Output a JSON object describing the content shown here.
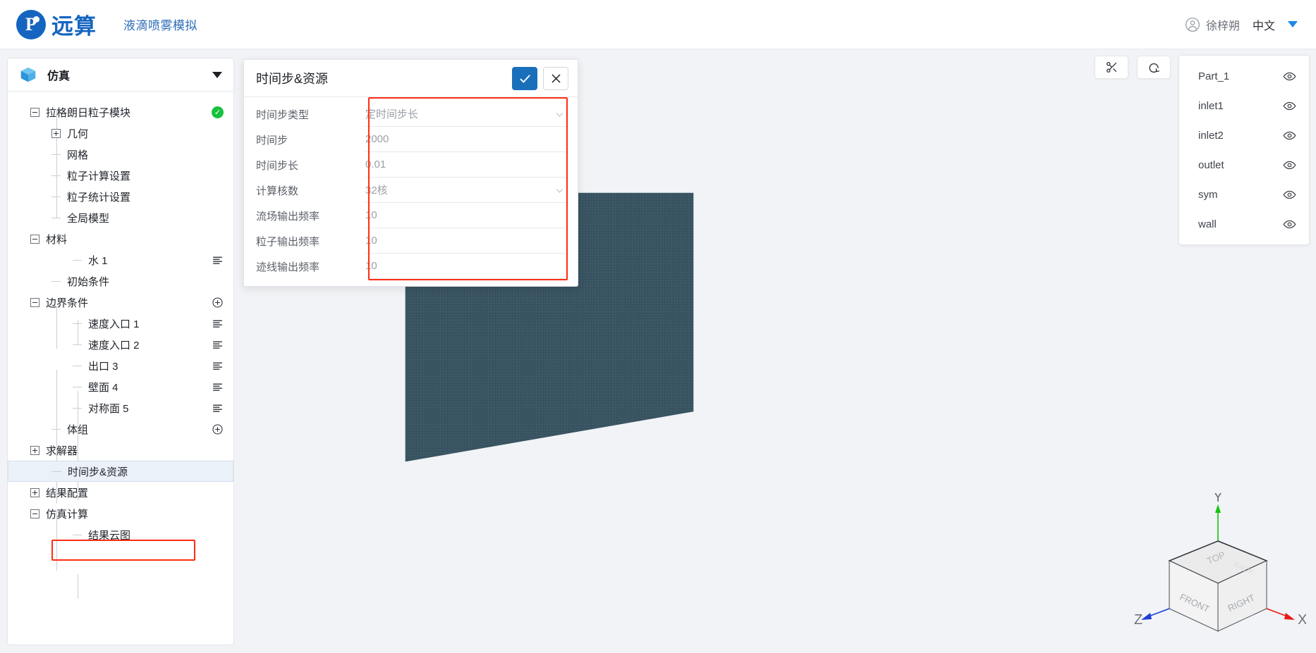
{
  "topbar": {
    "brand_name": "远算",
    "brand_glyph": "P",
    "app_title": "液滴喷雾模拟",
    "user_name": "徐梓朔",
    "language": "中文",
    "avatar_icon": "user-circle-icon",
    "caret_icon": "caret-down-icon",
    "brand_color": "#1565c0",
    "app_title_color": "#2b6cb8"
  },
  "sidebar": {
    "header": {
      "title": "仿真",
      "icon": "cube-icon",
      "caret_icon": "caret-down-icon"
    },
    "tree": [
      {
        "label": "拉格朗日粒子模块",
        "depth": 0,
        "toggle": "minus",
        "status_icon": "check-circle-icon",
        "status_color": "#17c13e"
      },
      {
        "label": "几何",
        "depth": 1,
        "toggle": "plus"
      },
      {
        "label": "网格",
        "depth": 1,
        "toggle": "leaf"
      },
      {
        "label": "粒子计算设置",
        "depth": 1,
        "toggle": "leaf"
      },
      {
        "label": "粒子统计设置",
        "depth": 1,
        "toggle": "leaf"
      },
      {
        "label": "全局模型",
        "depth": 1,
        "toggle": "leaf"
      },
      {
        "label": "材料",
        "depth": 0,
        "toggle": "minus"
      },
      {
        "label": "水 1",
        "depth": 2,
        "toggle": "leaf",
        "row_icon": "list-lines-icon"
      },
      {
        "label": "初始条件",
        "depth": 1,
        "toggle": "leaf"
      },
      {
        "label": "边界条件",
        "depth": 0,
        "toggle": "minus",
        "row_icon": "plus-circle-icon"
      },
      {
        "label": "速度入口 1",
        "depth": 2,
        "toggle": "leaf",
        "row_icon": "list-lines-icon"
      },
      {
        "label": "速度入口 2",
        "depth": 2,
        "toggle": "leaf",
        "row_icon": "list-lines-icon"
      },
      {
        "label": "出口 3",
        "depth": 2,
        "toggle": "leaf",
        "row_icon": "list-lines-icon"
      },
      {
        "label": "壁面 4",
        "depth": 2,
        "toggle": "leaf",
        "row_icon": "list-lines-icon"
      },
      {
        "label": "对称面 5",
        "depth": 2,
        "toggle": "leaf",
        "row_icon": "list-lines-icon"
      },
      {
        "label": "体组",
        "depth": 1,
        "toggle": "leaf",
        "row_icon": "plus-circle-icon"
      },
      {
        "label": "求解器",
        "depth": 0,
        "toggle": "plus"
      },
      {
        "label": "时间步&资源",
        "depth": 1,
        "toggle": "leaf",
        "selected": true
      },
      {
        "label": "结果配置",
        "depth": 0,
        "toggle": "plus"
      },
      {
        "label": "仿真计算",
        "depth": 0,
        "toggle": "minus"
      },
      {
        "label": "结果云图",
        "depth": 2,
        "toggle": "leaf"
      }
    ]
  },
  "dialog": {
    "title": "时间步&资源",
    "confirm_icon": "check-icon",
    "cancel_icon": "close-icon",
    "confirm_color": "#1a6fbb",
    "fields": [
      {
        "label": "时间步类型",
        "value": "定时间步长",
        "type": "select"
      },
      {
        "label": "时间步",
        "value": "2000",
        "type": "input"
      },
      {
        "label": "时间步长",
        "value": "0.01",
        "type": "input"
      },
      {
        "label": "计算核数",
        "value": "32核",
        "type": "select"
      },
      {
        "label": "流场输出频率",
        "value": "10",
        "type": "input"
      },
      {
        "label": "粒子输出频率",
        "value": "10",
        "type": "input"
      },
      {
        "label": "迹线输出频率",
        "value": "10",
        "type": "input"
      }
    ]
  },
  "viewport": {
    "background_color": "#f1f3f6",
    "geometry_color": "#3a5360",
    "toolbar": [
      {
        "name": "clip-scissors-button",
        "icon": "scissors-icon"
      },
      {
        "name": "reset-view-button",
        "icon": "rotate-ccw-icon"
      }
    ],
    "parts": [
      {
        "label": "Part_1",
        "visibility_icon": "eye-icon"
      },
      {
        "label": "inlet1",
        "visibility_icon": "eye-icon"
      },
      {
        "label": "inlet2",
        "visibility_icon": "eye-icon"
      },
      {
        "label": "outlet",
        "visibility_icon": "eye-icon"
      },
      {
        "label": "sym",
        "visibility_icon": "eye-icon"
      },
      {
        "label": "wall",
        "visibility_icon": "eye-icon"
      }
    ],
    "nav_cube": {
      "faces": {
        "top": "TOP",
        "front": "FRONT",
        "right": "RIGHT",
        "back": "BACK"
      },
      "axes": {
        "x": "X",
        "y": "Y",
        "z": "Z"
      },
      "axis_colors": {
        "x": "#e81b12",
        "y": "#13c20e",
        "z": "#1d3fd6"
      }
    }
  },
  "highlight_color": "#ff2d13"
}
